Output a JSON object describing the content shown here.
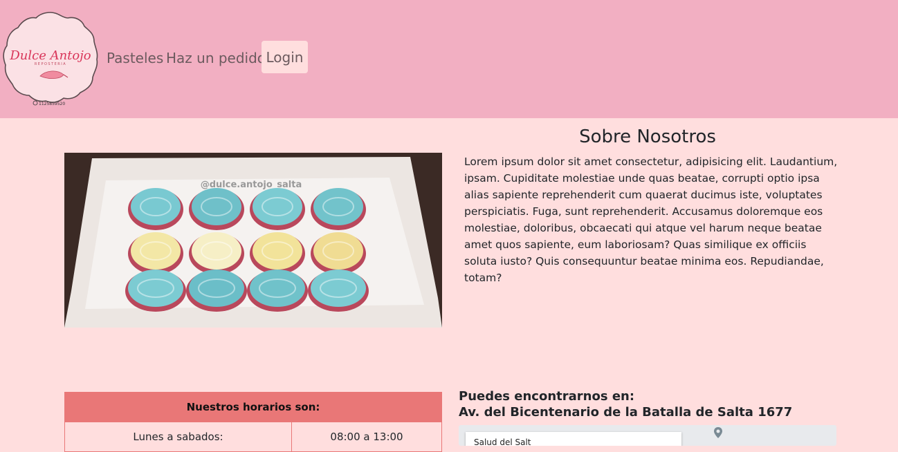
{
  "navbar": {
    "logo": {
      "brand": "Dulce Antojo",
      "sub": "REPOSTERIA",
      "phone": "1125859520"
    },
    "links": {
      "pasteles": "Pasteles",
      "pedido": "Haz un pedido",
      "login": "Login"
    }
  },
  "about": {
    "title": "Sobre Nosotros",
    "text": "Lorem ipsum dolor sit amet consectetur, adipisicing elit. Laudantium, ipsam. Cupiditate molestiae unde quas beatae, corrupti optio ipsa alias sapiente reprehenderit cum quaerat ducimus iste, voluptates perspiciatis. Fuga, sunt reprehenderit. Accusamus doloremque eos molestiae, doloribus, obcaecati qui atque vel harum neque beatae amet quos sapiente, eum laboriosam? Quas similique ex officiis soluta iusto? Quis consequuntur beatae minima eos. Repudiandae, totam?",
    "photo_watermark": "@dulce.antojo_salta"
  },
  "hours": {
    "header": "Nuestros horarios son:",
    "rows": [
      {
        "day": "Lunes a sabados:",
        "time": "08:00 a 13:00"
      }
    ]
  },
  "location": {
    "line1": "Puedes encontrarnos en:",
    "line2": "Av. del Bicentenario de la Batalla de Salta 1677",
    "map_card_text": "Salud del Salt"
  },
  "colors": {
    "navbar": "#f2afc2",
    "background": "#ffdede",
    "table_header": "#e97777"
  }
}
